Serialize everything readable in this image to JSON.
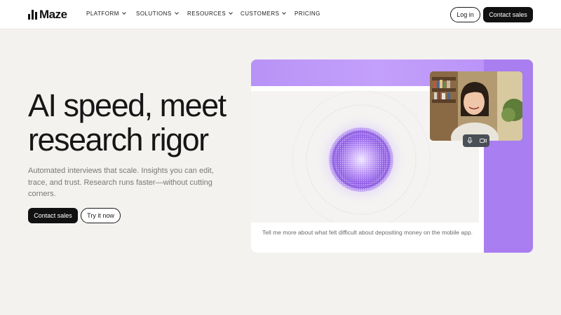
{
  "nav": {
    "logo_text": "Maze",
    "menu": [
      {
        "label": "PLATFORM",
        "has_dropdown": true
      },
      {
        "label": "SOLUTIONS",
        "has_dropdown": true
      },
      {
        "label": "RESOURCES",
        "has_dropdown": true
      },
      {
        "label": "CUSTOMERS",
        "has_dropdown": true
      },
      {
        "label": "PRICING",
        "has_dropdown": false
      }
    ],
    "login_label": "Log in",
    "contact_label": "Contact sales"
  },
  "hero": {
    "headline": "AI speed, meet research rigor",
    "subtext": "Automated interviews that scale. Insights you can edit, trace, and trust. Research runs faster—without cutting corners.",
    "primary_cta": "Contact sales",
    "secondary_cta": "Try it now"
  },
  "visual": {
    "caption": "Tell me more about what felt difficult about depositing money on the mobile app.",
    "controls": [
      "microphone-icon",
      "video-camera-icon"
    ],
    "accent_color": "#b48ef4"
  },
  "colors": {
    "background": "#f3f2ef",
    "button_dark": "#111111",
    "accent_purple": "#b48ef4"
  }
}
